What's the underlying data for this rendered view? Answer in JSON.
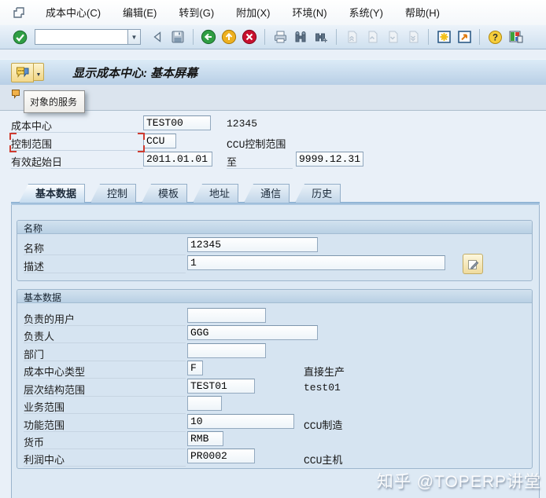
{
  "menu": {
    "items": [
      "成本中心(C)",
      "编辑(E)",
      "转到(G)",
      "附加(X)",
      "环境(N)",
      "系统(Y)",
      "帮助(H)"
    ]
  },
  "toolbar": {
    "command_value": "",
    "icons": [
      "enter-icon",
      "command-field",
      "back-triangle-icon",
      "save-icon",
      "back-icon",
      "exit-icon",
      "cancel-icon",
      "print-icon",
      "find-icon",
      "find-next-icon",
      "first-page-icon",
      "prev-page-icon",
      "next-page-icon",
      "last-page-icon",
      "new-session-icon",
      "create-shortcut-icon",
      "help-icon",
      "customize-layout-icon"
    ]
  },
  "title_bar": {
    "title": "显示成本中心: 基本屏幕",
    "services_icon": "services-for-object-icon"
  },
  "tooltip": {
    "text": "对象的服务"
  },
  "header_form": {
    "cost_center": {
      "label": "成本中心",
      "value": "TEST00",
      "note": "12345"
    },
    "controlling_area": {
      "label": "控制范围",
      "value": "CCU",
      "note": "CCU控制范围"
    },
    "valid_from": {
      "label": "有效起始日",
      "value": "2011.01.01",
      "to_label": "至",
      "to_value": "9999.12.31"
    }
  },
  "tabs": {
    "items": [
      "基本数据",
      "控制",
      "模板",
      "地址",
      "通信",
      "历史"
    ],
    "active": "基本数据"
  },
  "name_section": {
    "header": "名称",
    "name": {
      "label": "名称",
      "value": "12345"
    },
    "description": {
      "label": "描述",
      "value": "1"
    }
  },
  "basic_section": {
    "header": "基本数据",
    "rows": [
      {
        "label": "负责的用户",
        "value": "",
        "note": ""
      },
      {
        "label": "负责人",
        "value": "GGG",
        "note": ""
      },
      {
        "label": "部门",
        "value": "",
        "note": ""
      },
      {
        "label": "成本中心类型",
        "value": "F",
        "note": "直接生产"
      },
      {
        "label": "层次结构范围",
        "value": "TEST01",
        "note": "test01"
      },
      {
        "label": "业务范围",
        "value": "",
        "note": ""
      },
      {
        "label": "功能范围",
        "value": "10",
        "note": "CCU制造"
      },
      {
        "label": "货币",
        "value": "RMB",
        "note": ""
      },
      {
        "label": "利润中心",
        "value": "PR0002",
        "note": "CCU主机"
      }
    ]
  },
  "watermark": "知乎 @TOPERP讲堂",
  "colors": {
    "content_bg": "#e9f0f8",
    "panel_bg": "#dde9f4",
    "group_bg": "#d6e4f1",
    "title_band_top": "#dcebf7",
    "title_band_bottom": "#b7cee5",
    "cursor_mark_red": "#cf3b30",
    "enter_green": "#2f9e44",
    "exit_yellow": "#edb01f",
    "cancel_red": "#c8102e"
  }
}
